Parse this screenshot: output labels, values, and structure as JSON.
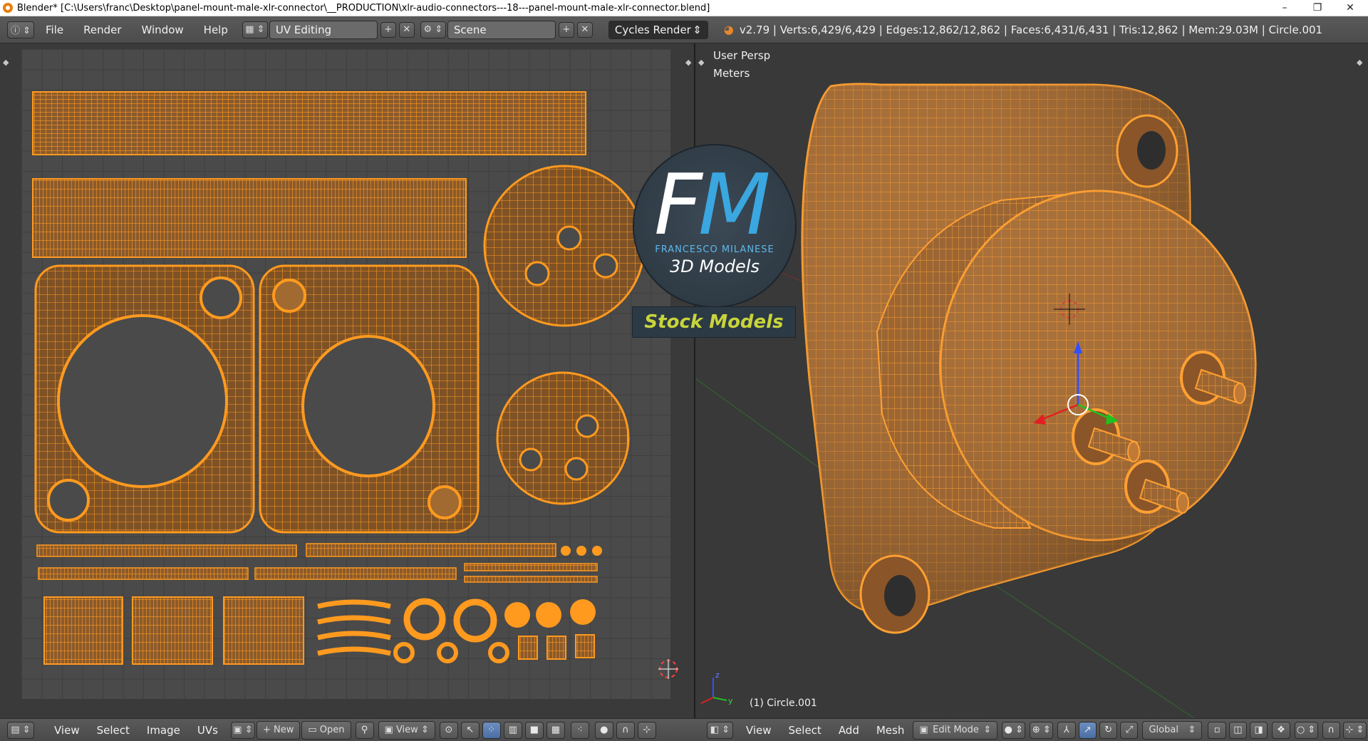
{
  "window": {
    "title": "Blender* [C:\\Users\\franc\\Desktop\\panel-mount-male-xlr-connector\\__PRODUCTION\\xlr-audio-connectors---18---panel-mount-male-xlr-connector.blend]",
    "minimize": "–",
    "maximize": "❐",
    "close": "✕"
  },
  "info_header": {
    "menus": [
      "File",
      "Render",
      "Window",
      "Help"
    ],
    "screen_layout": "UV Editing",
    "scene": "Scene",
    "render_engine": "Cycles Render",
    "stats": "v2.79 | Verts:6,429/6,429 | Edges:12,862/12,862 | Faces:6,431/6,431 | Tris:12,862 | Mem:29.03M | Circle.001"
  },
  "uv_editor": {
    "bottom_menus": [
      "View",
      "Select",
      "Image",
      "UVs"
    ],
    "new_button": "New",
    "open_button": "Open",
    "view_dropdown": "View"
  },
  "viewport": {
    "view_label": "User Persp",
    "units_label": "Meters",
    "object_label": "(1) Circle.001",
    "bottom_menus": [
      "View",
      "Select",
      "Add",
      "Mesh"
    ],
    "mode": "Edit Mode",
    "orientation": "Global"
  },
  "watermark": {
    "letters_f": "F",
    "letters_m": "M",
    "brand": "FRANCESCO MILANESE",
    "subtitle": "3D Models",
    "banner": "Stock Models"
  },
  "colors": {
    "wire": "#ff9a1f",
    "mesh_fill": "#a8703a",
    "accent_blue": "#3aa7e0",
    "banner_text": "#c9d43a"
  }
}
